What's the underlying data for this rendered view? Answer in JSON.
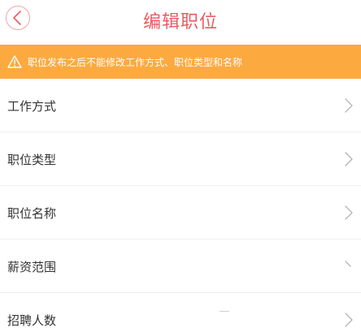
{
  "header": {
    "back_icon": "chevron-left-icon",
    "title": "编辑职位",
    "title_color": "#ec5a63"
  },
  "warning": {
    "icon": "warning-triangle-icon",
    "text": "职位发布之后不能修改工作方式、职位类型和名称",
    "background": "#fcaa3f"
  },
  "form": {
    "rows": [
      {
        "label": "工作方式",
        "icon": "chevron-right-icon"
      },
      {
        "label": "职位类型",
        "icon": "chevron-right-icon"
      },
      {
        "label": "职位名称",
        "icon": "chevron-right-icon"
      },
      {
        "label": "薪资范围",
        "icon": "chevron-right-icon"
      },
      {
        "label": "招聘人数",
        "icon": "chevron-right-icon"
      }
    ]
  }
}
